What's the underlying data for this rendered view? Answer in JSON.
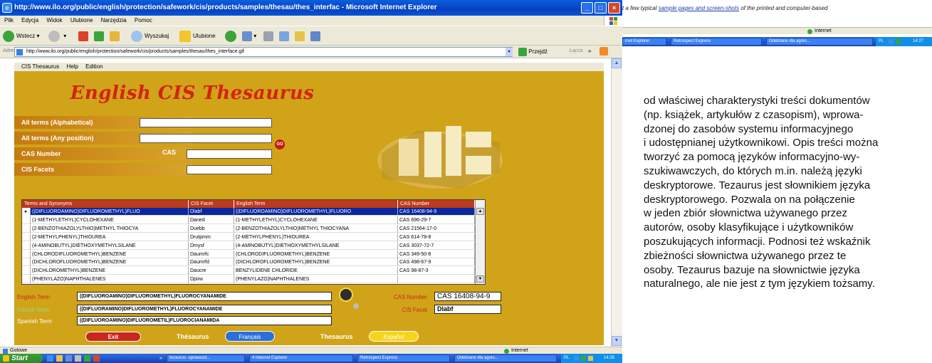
{
  "window": {
    "title": "http://www.ilo.org/public/english/protection/safework/cis/products/samples/thesau/thes_interfac - Microsoft Internet Explorer",
    "menu": [
      "Plik",
      "Edycja",
      "Widok",
      "Ulubione",
      "Narzędzia",
      "Pomoc"
    ],
    "toolbar": {
      "back": "Wstecz",
      "search": "Wyszukaj",
      "favorites": "Ulubione"
    },
    "address": {
      "label": "Adres",
      "url": "http://www.ilo.org/public/english/protection/safework/cis/products/samples/thesau/thes_interface.gif",
      "go": "Przejdź",
      "links": "Łącza"
    },
    "status": {
      "left": "Gotowe",
      "right": "Internet"
    }
  },
  "app": {
    "menu": [
      "CIS Thesaurus",
      "Help",
      "Edition"
    ],
    "title": "English CIS Thesaurus",
    "fields": {
      "alpha_label": "All terms (Alphabetical)",
      "any_label": "All terms (Any position)",
      "cas_label": "CAS Number",
      "cas_small": "CAS",
      "facets_label": "CIS Facets",
      "go": "GO"
    },
    "table": {
      "headers": [
        "Terms and Synonyms",
        "CIS Facet",
        "English Term",
        "CAS Number"
      ],
      "rows": [
        [
          "((DIFLUOROAMINO)DIFLUOROMETHYL)FLUO",
          "Dlabf",
          "((DIFLUOROAMINO)DIFLUOROMETHYL)FLUORO",
          "CAS 16408-94-9"
        ],
        [
          "(1-METHYLETHYL)CYCLOHEXANE",
          "Daned",
          "(1-METHYLETHYL)CYCLOHEXANE",
          "CAS 696-29-7"
        ],
        [
          "(2-BENZOTHIAZOLYLTHIO)METHYL THIOCYA",
          "Duebb",
          "(2-BENZOTHIAZOLYLTHIO)METHYL THIOCYANA",
          "CAS 21564-17-0"
        ],
        [
          "(2-METHYLPHENYL)THIOUREA",
          "Drutpmm",
          "(2-METHYLPHENYL)THIOUREA",
          "CAS 614-78-8"
        ],
        [
          "(4-AMINOBUTYL)DIETHOXYMETHYLSILANE",
          "Dmysf",
          "(4-AMINOBUTYL)DIETHOXYMETHYLSILANE",
          "CAS 3037-72-7"
        ],
        [
          "(CHLORODIFLUOROMETHYL)BENZENE",
          "Daumrfc",
          "(CHLORODIFLUOROMETHYL)BENZENE",
          "CAS 349-50-8"
        ],
        [
          "(DICHLOROFLUOROMETHYL)BENZENE",
          "Daumrfd",
          "(DICHLOROFLUOROMETHYL)BENZENE",
          "CAS 498-67-9"
        ],
        [
          "(DICHLOROMETHYL)BENZENE",
          "Daucre",
          "BENZYLIDENE CHLORIDE",
          "CAS 98-87-3"
        ],
        [
          "(PHENYLAZO)NAPHTHALENES",
          "Dpirw",
          "(PHENYLAZO)NAPHTHALENES",
          ""
        ]
      ]
    },
    "terms": {
      "english_label": "English Term",
      "english_value": "((DIFLUOROAMINO)DIFLUOROMETHYL)FLUOROCYANAMIDE",
      "french_label": "French Term",
      "french_value": "((DIFLUORAMINO)DIFLUOROMETHYL)FLUOROCYANAMIDE",
      "spanish_label": "Spanish Term",
      "spanish_value": "((DIFLUOROAMINO)DIFLUOROMETIL)FLUOROCIANAMIDA",
      "cas_label": "CAS Number",
      "cas_value": "CAS 16408-94-9",
      "facet_label": "CIS Facet",
      "facet_value": "Dlabf"
    },
    "buttons": {
      "exit": "Exit",
      "thes_fr_label": "Thésaurus",
      "francais": "Français",
      "thes_es_label": "Thesaurus",
      "espanol": "Español"
    }
  },
  "taskbar": {
    "start": "Start",
    "tasks": [
      "tezaurus -sprawozd...",
      "4 Internet Explorer",
      "Retrospect Express",
      "Odebrane dla agnio..."
    ],
    "tray_lang": "PL",
    "clock": "14:28"
  },
  "right_top": {
    "text_prefix": "t a few typical ",
    "link": "sample pages and screen-shots",
    "text_suffix": " of the printed and computer-based",
    "status": "Internet",
    "tasks": [
      "rnet Explorer",
      "Retrospect Express",
      "Odebrane dla agnio..."
    ],
    "tray_lang": "PL",
    "clock": "14:27"
  },
  "document": {
    "lines": [
      "od właściwej charakterystyki treści dokumentów",
      "(np. książek, artykułów z czasopism), wprowa-",
      "dzonej do zasobów systemu informacyjnego",
      "i udostępnianej użytkownikowi. Opis treści można",
      "tworzyć za pomocą języków informacyjno-wy-",
      "szukiwawczych, do których m.in. należą języki",
      "deskryptorowe. Tezaurus jest słownikiem języka",
      "deskryptorowego. Pozwala on na połączenie",
      "w jeden zbiór słownictwa używanego przez",
      "autorów, osoby klasyfikujące i użytkowników",
      "poszukujących informacji. Podnosi też wskaźnik",
      "zbieżności słownictwa używanego przez te",
      "osoby. Tezaurus bazuje na słownictwie języka",
      "naturalnego, ale nie jest z tym językiem tożsamy."
    ]
  },
  "colors": {
    "app_bg": "#d1a319",
    "title_red": "#d42310",
    "table_header": "#bd3a1a",
    "selected_row": "#0a27a0",
    "xp_blue": "#0a5fe0"
  }
}
